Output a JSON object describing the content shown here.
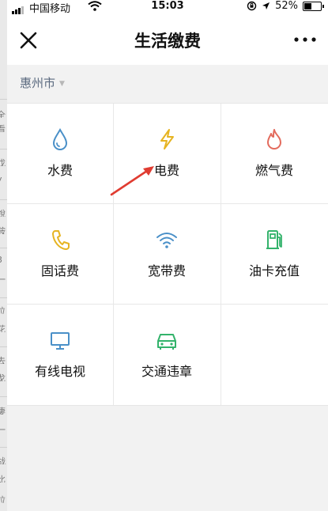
{
  "status_bar": {
    "carrier": "中国移动",
    "time": "15:03",
    "battery": "52%",
    "battery_level": 0.52
  },
  "header": {
    "title": "生活缴费"
  },
  "city": {
    "name": "惠州市"
  },
  "services": [
    {
      "label": "水费",
      "icon": "water-drop-icon",
      "color": "#4a90c8"
    },
    {
      "label": "电费",
      "icon": "lightning-icon",
      "color": "#e6b422"
    },
    {
      "label": "燃气费",
      "icon": "flame-icon",
      "color": "#e36b5d"
    },
    {
      "label": "固话费",
      "icon": "phone-icon",
      "color": "#e6b422"
    },
    {
      "label": "宽带费",
      "icon": "wifi-icon",
      "color": "#4a90c8"
    },
    {
      "label": "油卡充值",
      "icon": "gas-pump-icon",
      "color": "#33b36b"
    },
    {
      "label": "有线电视",
      "icon": "tv-icon",
      "color": "#4a90c8"
    },
    {
      "label": "交通违章",
      "icon": "car-icon",
      "color": "#33b36b"
    }
  ],
  "edge_fragments": [
    "全",
    "看",
    "戊",
    "y",
    "銳",
    "鞍",
    "3",
    "一",
    "位",
    "花",
    "去",
    "戈",
    "凄",
    "一",
    "战",
    "比",
    "拉",
    "一"
  ]
}
